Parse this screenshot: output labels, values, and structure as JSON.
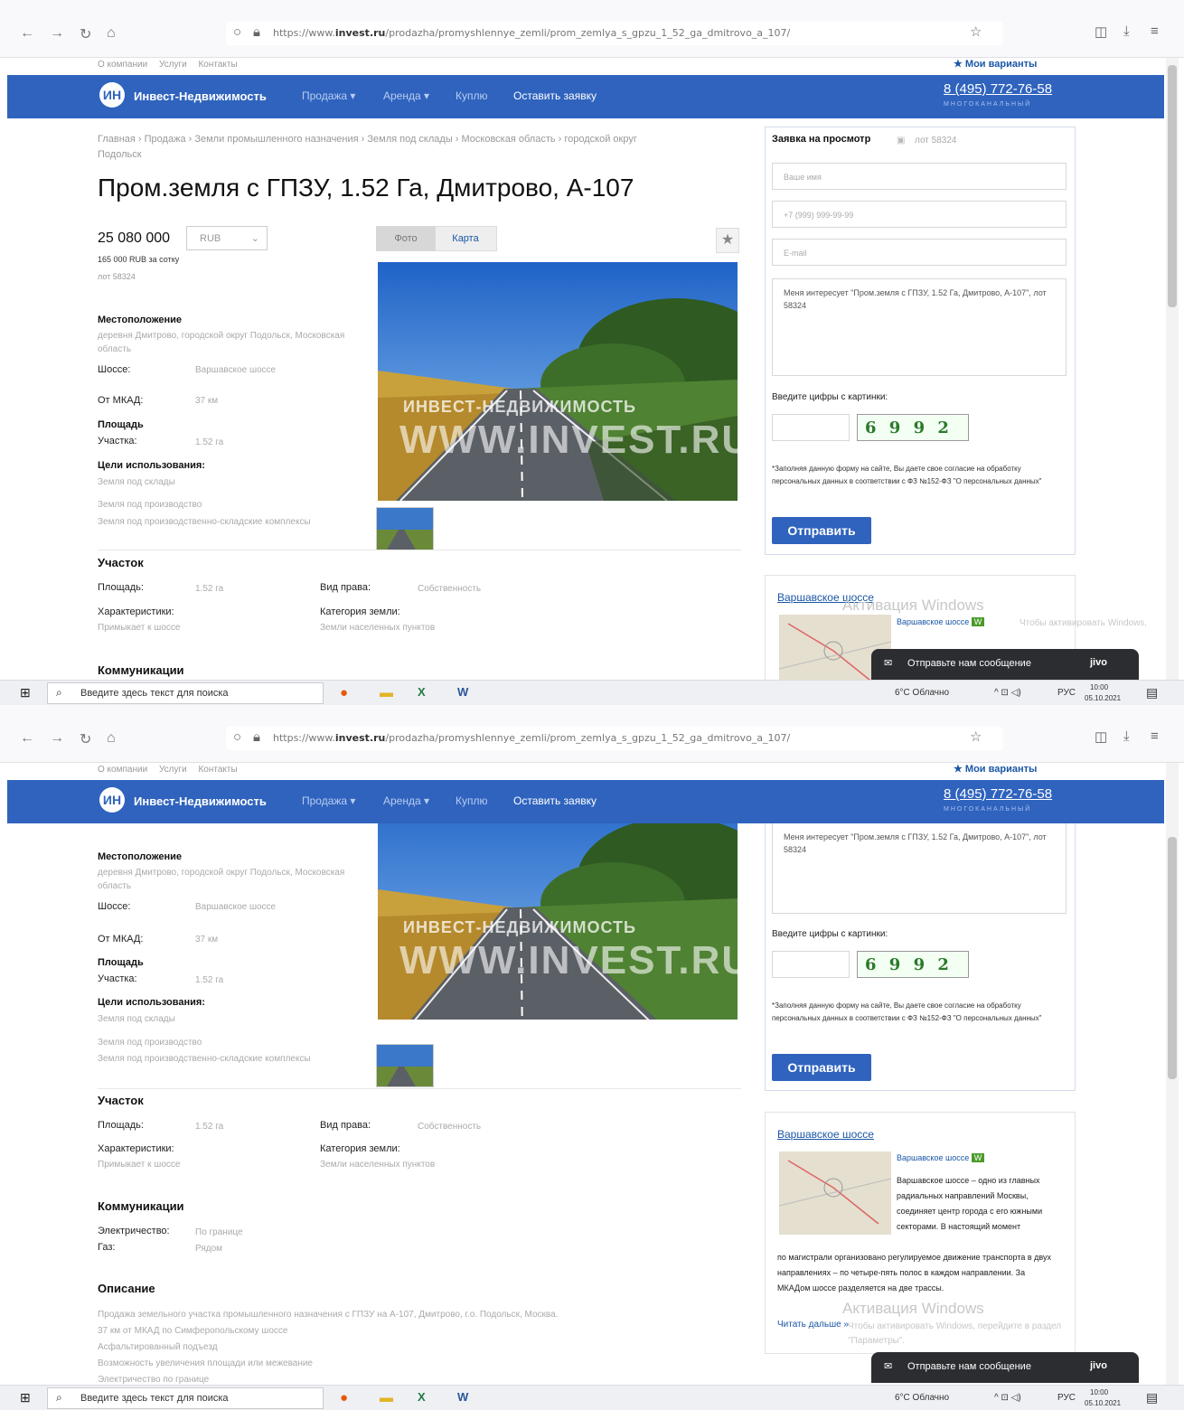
{
  "browser": {
    "url_prefix": "https://www.",
    "url_host": "invest.ru",
    "url_path": "/prodazha/promyshlennye_zemli/prom_zemlya_s_gpzu_1_52_ga_dmitrovo_a_107/"
  },
  "site": {
    "top_links": [
      "О компании",
      "Услуги",
      "Контакты"
    ],
    "my_variants": "Мои варианты",
    "logo_text": "ИН",
    "brand": "Инвест-Недвижимость",
    "menu": [
      "Продажа ▾",
      "Аренда ▾",
      "Куплю",
      "Оставить заявку"
    ],
    "phone": "8 (495) 772-76-58",
    "phone_sub": "МНОГОКАНАЛЬНЫЙ"
  },
  "listing": {
    "breadcrumb": "Главная › Продажа › Земли промышленного назначения › Земля под склады › Московская область › городской округ Подольск",
    "title": "Пром.земля с ГПЗУ, 1.52 Га, Дмитрово, А-107",
    "price": "25 080 000",
    "currency": "RUB",
    "price_per": "165 000 RUB  за сотку",
    "lot": "лот 58324",
    "location_label": "Местоположение",
    "location": "деревня Дмитрово, городской округ Подольск, Московская область",
    "highway_label": "Шоссе:",
    "highway": "Варшавское шоссе",
    "mkad_label": "От МКАД:",
    "mkad": "37 км",
    "area_label": "Площадь",
    "plot_label": "Участка:",
    "plot": "1.52 га",
    "usage_label": "Цели использования:",
    "usage": [
      "Земля под склады",
      "Земля под производство",
      "Земля под производственно-складские комплексы"
    ],
    "tab_photo": "Фото",
    "tab_map": "Карта",
    "watermark_top": "ИНВЕСТ-НЕДВИЖИМОСТЬ",
    "watermark": "WWW.INVEST.RU"
  },
  "section": {
    "plot_title": "Участок",
    "area_key": "Площадь:",
    "area_val": "1.52 га",
    "right_key": "Вид права:",
    "right_val": "Собственность",
    "char_key": "Характеристики:",
    "char_val": "Примыкает к шоссе",
    "cat_key": "Категория земли:",
    "cat_val": "Земли населенных пунктов",
    "comm_title": "Коммуникации",
    "elec_key": "Электричество:",
    "elec_val": "По границе",
    "gas_key": "Газ:",
    "gas_val": "Рядом",
    "desc_title": "Описание",
    "desc": [
      "Продажа земельного участка промышленного назначения с ГПЗУ на А-107, Дмитрово, г.о. Подольск, Москва.",
      "37 км от МКАД по Симферопольскому шоссе",
      "Асфальтированный подъезд",
      "Возможность увеличения площади или межевание",
      "Электричество по границе"
    ]
  },
  "form": {
    "title": "Заявка на просмотр",
    "sub": "лот 58324",
    "name_ph": "Ваше имя",
    "phone_ph": "+7 (999) 999-99-99",
    "email_ph": "E-mail",
    "message": "Меня интересует \"Пром.земля с ГПЗУ, 1.52 Га, Дмитрово, А-107\", лот 58324",
    "captcha_label": "Введите цифры с картинки:",
    "captcha": "6 9 9 2",
    "consent": "*Заполняя данную форму на сайте, Вы даете свое согласие на обработку персональных данных в соответствии с ФЗ №152-ФЗ \"О персональных данных\"",
    "send": "Отправить"
  },
  "highway_card": {
    "title": "Варшавское шоссе",
    "link": "Варшавское шоссе",
    "badge": "W",
    "text_side": "Варшавское шоссе – одно из главных радиальных направлений Москвы, соединяет центр города с его южными секторами. В настоящий момент",
    "text_full": "по магистрали организовано регулируемое движение транспорта в двух направлениях – по четыре-пять полос в каждом направлении. За МКАДом шоссе разделяется на две трассы.",
    "read_more": "Читать дальше »"
  },
  "overlay": {
    "activation": "Активация Windows",
    "activation_sub": "Чтобы активировать Windows, перейдите в раздел",
    "activation_sub2": "\"Параметры\".",
    "chat": "Отправьте нам сообщение",
    "chat_brand": "jivo"
  },
  "taskbar": {
    "search": "Введите здесь текст для поиска",
    "weather": "6°C  Облачно",
    "lang": "РУС",
    "time": "10:00",
    "date": "05.10.2021"
  },
  "colors": {
    "brand_blue": "#2f63be",
    "link": "#1a56a6"
  }
}
